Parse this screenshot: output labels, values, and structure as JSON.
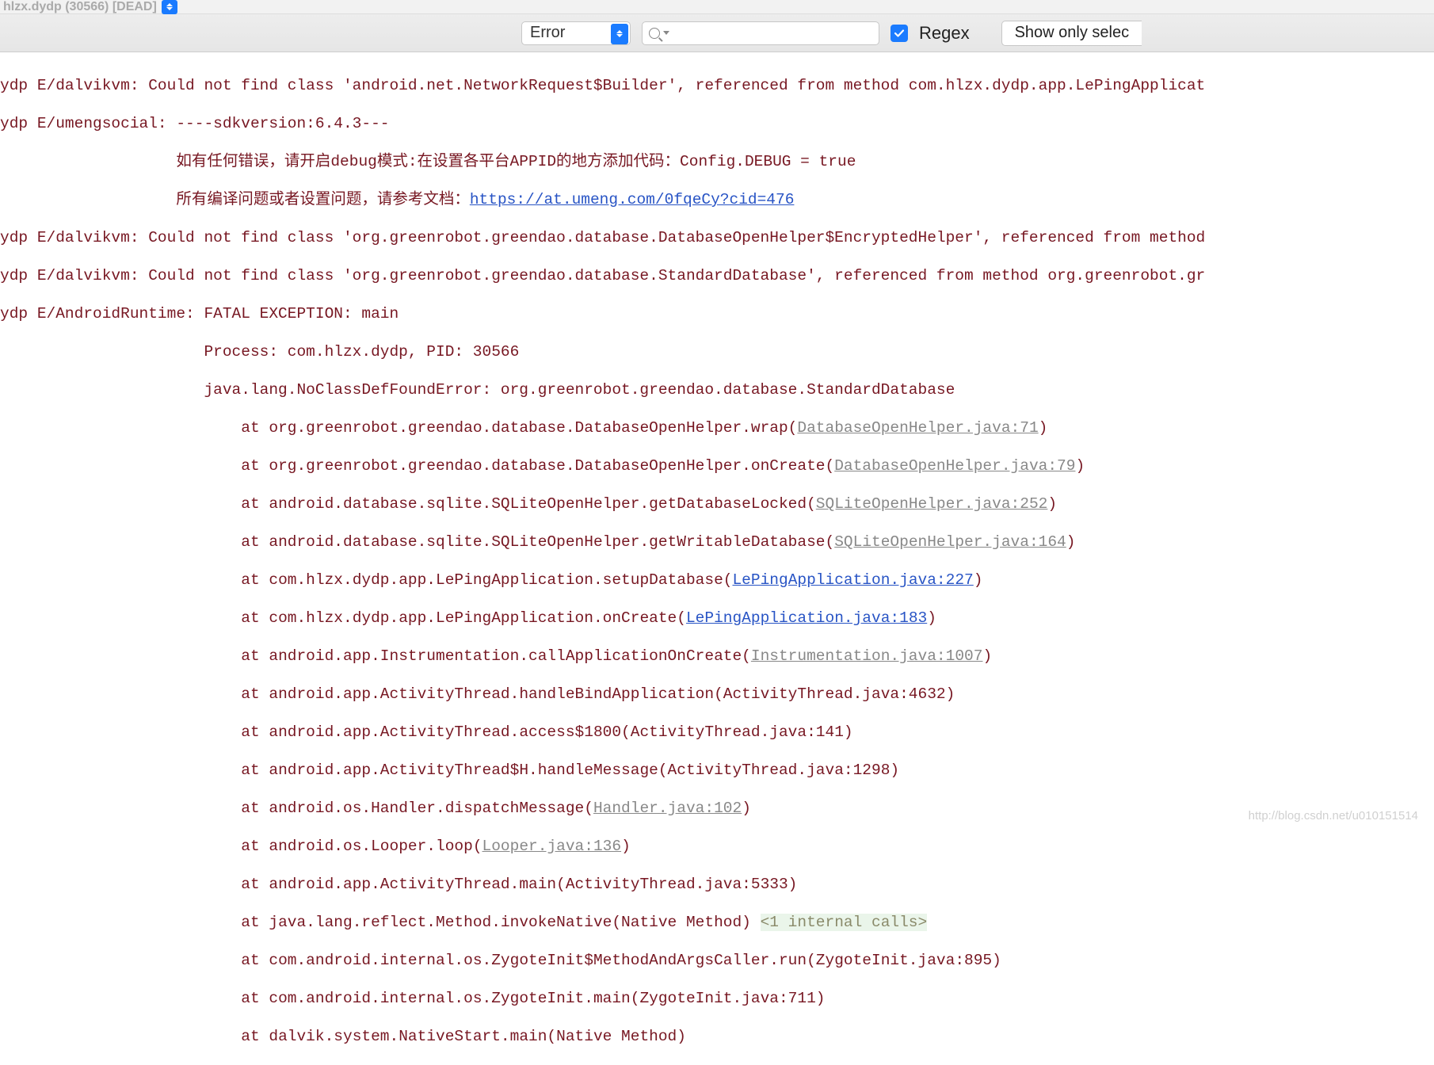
{
  "header": {
    "process_label": "hlzx.dydp (30566) [DEAD]"
  },
  "filter": {
    "level": "Error",
    "search_value": "",
    "regex_label": "Regex",
    "regex_checked": true,
    "show_button": "Show only selec"
  },
  "log": {
    "prefix": "ydp ",
    "lines": {
      "l1a": "E/dalvikvm: Could not find class 'android.net.NetworkRequest$Builder', referenced from method com.hlzx.dydp.app.LePingApplicat",
      "l2a": "E/umengsocial: ----sdkversion:6.4.3---",
      "l2b": "               如有任何错误，请开启debug模式:在设置各平台APPID的地方添加代码：Config.DEBUG = true",
      "l2c_pre": "               所有编译问题或者设置问题，请参考文档：",
      "l2c_link": "https://at.umeng.com/0fqeCy?cid=476",
      "l3a": "E/dalvikvm: Could not find class 'org.greenrobot.greendao.database.DatabaseOpenHelper$EncryptedHelper', referenced from method",
      "l4a": "E/dalvikvm: Could not find class 'org.greenrobot.greendao.database.StandardDatabase', referenced from method org.greenrobot.gr",
      "l5a": "E/AndroidRuntime: FATAL EXCEPTION: main",
      "l5b": "                  Process: com.hlzx.dydp, PID: 30566",
      "l5c": "                  java.lang.NoClassDefFoundError: org.greenrobot.greendao.database.StandardDatabase",
      "st_at": "                      at ",
      "st1_pre": "org.greenrobot.greendao.database.DatabaseOpenHelper.wrap(",
      "st1_link": "DatabaseOpenHelper.java:71",
      "st2_pre": "org.greenrobot.greendao.database.DatabaseOpenHelper.onCreate(",
      "st2_link": "DatabaseOpenHelper.java:79",
      "st3_pre": "android.database.sqlite.SQLiteOpenHelper.getDatabaseLocked(",
      "st3_link": "SQLiteOpenHelper.java:252",
      "st4_pre": "android.database.sqlite.SQLiteOpenHelper.getWritableDatabase(",
      "st4_link": "SQLiteOpenHelper.java:164",
      "st5_pre": "com.hlzx.dydp.app.LePingApplication.setupDatabase(",
      "st5_link": "LePingApplication.java:227",
      "st6_pre": "com.hlzx.dydp.app.LePingApplication.onCreate(",
      "st6_link": "LePingApplication.java:183",
      "st7_pre": "android.app.Instrumentation.callApplicationOnCreate(",
      "st7_link": "Instrumentation.java:1007",
      "st8": "android.app.ActivityThread.handleBindApplication(ActivityThread.java:4632)",
      "st9": "android.app.ActivityThread.access$1800(ActivityThread.java:141)",
      "st10": "android.app.ActivityThread$H.handleMessage(ActivityThread.java:1298)",
      "st11_pre": "android.os.Handler.dispatchMessage(",
      "st11_link": "Handler.java:102",
      "st12_pre": "android.os.Looper.loop(",
      "st12_link": "Looper.java:136",
      "st13": "android.app.ActivityThread.main(ActivityThread.java:5333)",
      "st14_pre": "java.lang.reflect.Method.invokeNative(Native Method) ",
      "st14_hl": "<1 internal calls>",
      "st15": "com.android.internal.os.ZygoteInit$MethodAndArgsCaller.run(ZygoteInit.java:895)",
      "st16": "com.android.internal.os.ZygoteInit.main(ZygoteInit.java:711)",
      "st17": "dalvik.system.NativeStart.main(Native Method)",
      "close": ")"
    }
  },
  "watermark": "http://blog.csdn.net/u010151514"
}
